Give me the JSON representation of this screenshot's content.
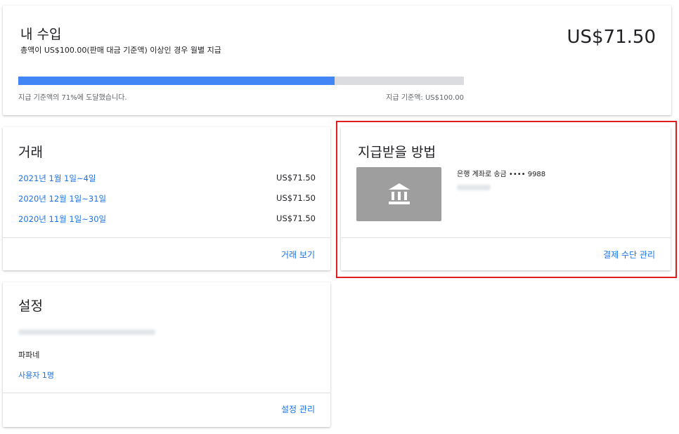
{
  "earnings": {
    "title": "내 수입",
    "subtitle": "총액이 US$100.00(판매 대금 기준액) 이상인 경우 월별 지급",
    "amount": "US$71.50",
    "progress_fraction": 0.71,
    "progress_text": "지급 기준액의 71%에 도달했습니다.",
    "threshold_text": "지급 기준액: US$100.00"
  },
  "transactions": {
    "title": "거래",
    "rows": [
      {
        "date": "2021년 1월 1일~4일",
        "amount": "US$71.50"
      },
      {
        "date": "2020년 12월 1일~31일",
        "amount": "US$71.50"
      },
      {
        "date": "2020년 11월 1일~30일",
        "amount": "US$71.50"
      }
    ],
    "view_link": "거래 보기"
  },
  "payment": {
    "title": "지급받을 방법",
    "method_label": "은행 계좌로 송금 •••• 9988",
    "manage_link": "결제 수단 관리",
    "icon": "bank-icon"
  },
  "settings": {
    "title": "설정",
    "name": "파파네",
    "users_link": "사용자 1명",
    "manage_link": "설정 관리"
  },
  "colors": {
    "accent": "#1a73e8",
    "progress": "#4285f4",
    "highlight": "#e01e1e"
  }
}
